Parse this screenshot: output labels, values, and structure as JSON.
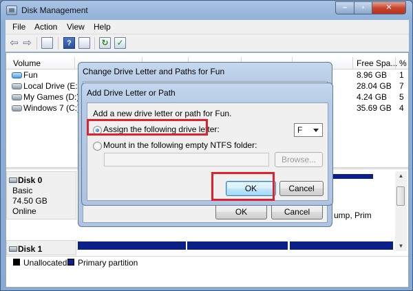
{
  "window": {
    "title": "Disk Management"
  },
  "menu": [
    "File",
    "Action",
    "View",
    "Help"
  ],
  "toolbar": {
    "icons": [
      "back-arrow-icon",
      "forward-arrow-icon",
      "console-tree-icon",
      "help-icon",
      "properties-icon",
      "refresh-icon",
      "export-icon"
    ],
    "help_glyph": "?",
    "arrow_back": "⇦",
    "arrow_fwd": "⇨"
  },
  "volumes": {
    "columns": [
      "Volume",
      "Free Spa...",
      "%"
    ],
    "rows": [
      {
        "name": "Fun",
        "free": "8.96 GB",
        "pct": "1"
      },
      {
        "name": "Local Drive (E:)",
        "free": "28.04 GB",
        "pct": "7"
      },
      {
        "name": "My Games (D:)",
        "free": "4.24 GB",
        "pct": "5"
      },
      {
        "name": "Windows 7 (C:)",
        "free": "35.69 GB",
        "pct": "4"
      }
    ]
  },
  "disks": [
    {
      "name": "Disk 0",
      "type": "Basic",
      "size": "74.50 GB",
      "status": "Online"
    },
    {
      "name": "Disk 1",
      "type": "",
      "size": "",
      "status": ""
    }
  ],
  "partition_fragment": "ump, Prim",
  "legend": [
    {
      "label": "Unallocated",
      "color": "#000000"
    },
    {
      "label": "Primary partition",
      "color": "#0b1f8a"
    }
  ],
  "dialog_outer": {
    "title": "Change Drive Letter and Paths for Fun",
    "ok_label": "OK",
    "cancel_label": "Cancel"
  },
  "dialog_inner": {
    "title": "Add Drive Letter or Path",
    "description": "Add a new drive letter or path for Fun.",
    "option_assign": "Assign the following drive letter:",
    "option_mount": "Mount in the following empty NTFS folder:",
    "selected_letter": "F",
    "browse_label": "Browse...",
    "ok_label": "OK",
    "cancel_label": "Cancel"
  },
  "colors": {
    "highlight": "#e0202b",
    "partition": "#0b1f8a"
  }
}
